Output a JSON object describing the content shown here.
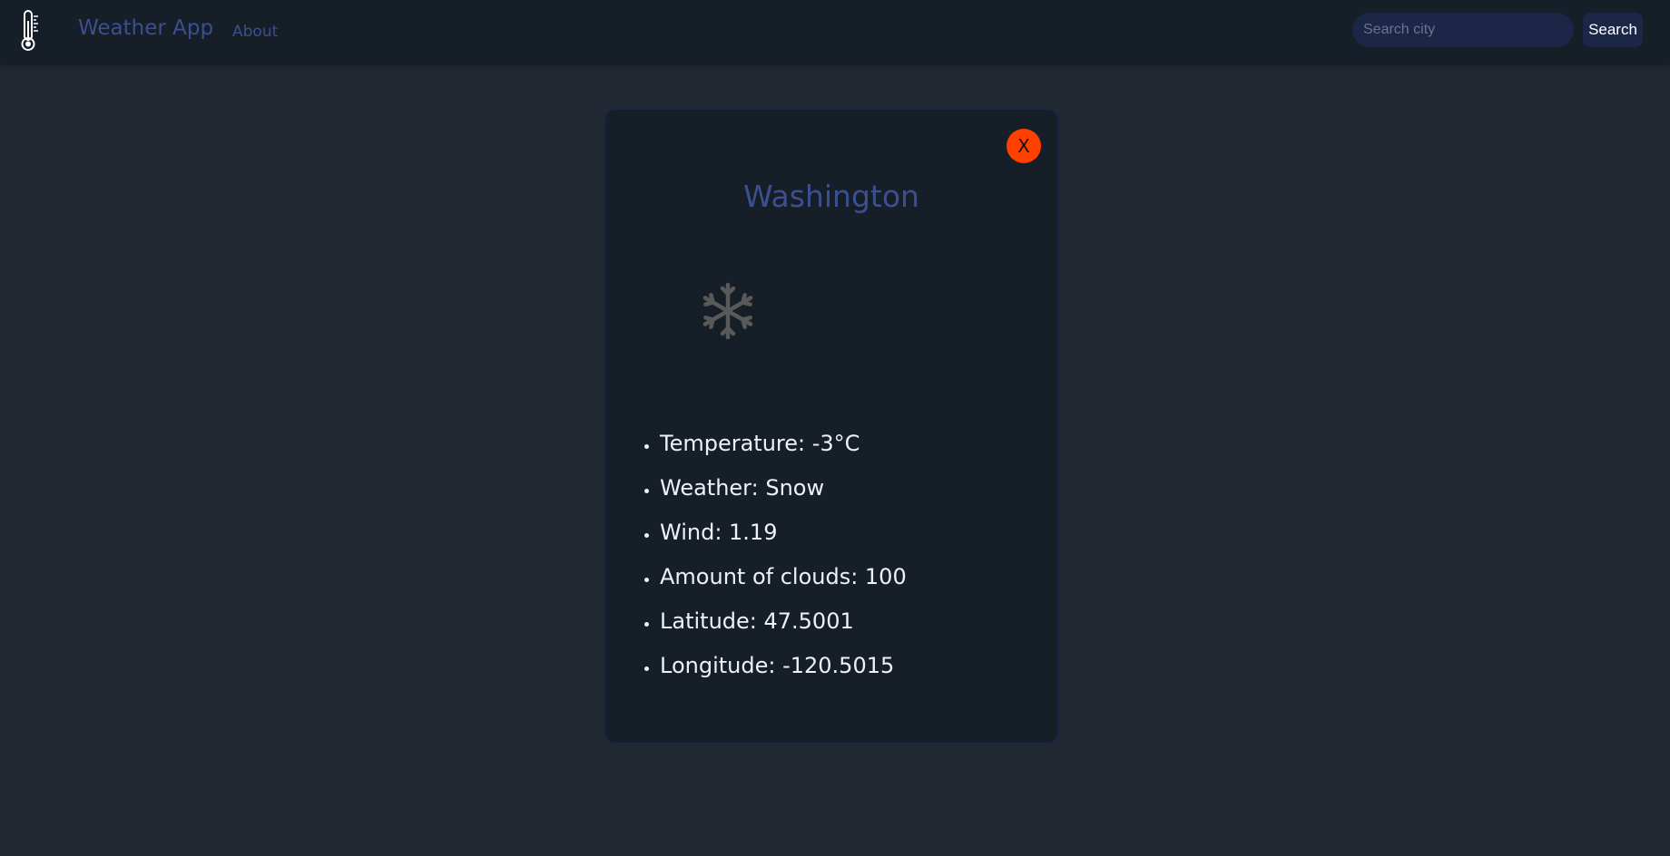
{
  "navbar": {
    "brand": "Weather App",
    "about": "About",
    "search_placeholder": "Search city",
    "search_button": "Search"
  },
  "card": {
    "close_label": "X",
    "city": "Washington",
    "weather_icon": "snowflake-icon",
    "details": [
      "Temperature: -3°C",
      "Weather: Snow",
      "Wind: 1.19",
      "Amount of clouds: 100",
      "Latitude: 47.5001",
      "Longitude: -120.5015"
    ]
  },
  "colors": {
    "background": "#222831",
    "navbar": "#161e27",
    "accent_text": "#3c4f91",
    "input_bg": "#1c2647",
    "close_button": "#ff4000"
  }
}
